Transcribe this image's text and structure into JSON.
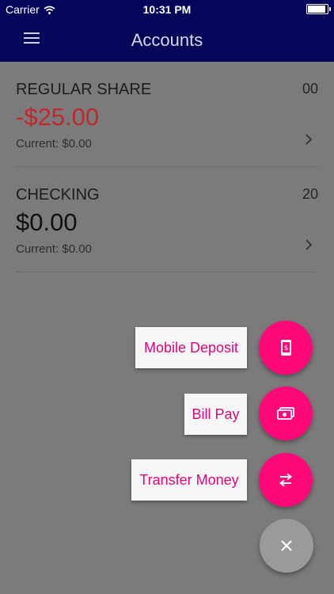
{
  "status_bar": {
    "carrier": "Carrier",
    "time": "10:31 PM",
    "battery_level": 1.0
  },
  "app_bar": {
    "title": "Accounts",
    "menu_icon": "menu-icon"
  },
  "accounts": [
    {
      "name": "REGULAR SHARE",
      "number": "00",
      "balance": "-$25.00",
      "current": "Current: $0.00",
      "balance_color": "#c0282d"
    },
    {
      "name": "CHECKING",
      "number": "20",
      "balance": "$0.00",
      "current": "Current: $0.00",
      "balance_color": "#111111"
    }
  ],
  "actions": {
    "mobile_deposit": {
      "label": "Mobile Deposit",
      "icon": "mobile-deposit-icon"
    },
    "bill_pay": {
      "label": "Bill Pay",
      "icon": "cash-icon"
    },
    "transfer_money": {
      "label": "Transfer Money",
      "icon": "transfer-icon"
    },
    "close": {
      "icon": "close-icon"
    }
  },
  "colors": {
    "app_bar": "#05055a",
    "overlay": "#7b7b7b",
    "fab": "#ff0877",
    "fab_close": "#9a9a9a",
    "action_text": "#d8097a"
  }
}
